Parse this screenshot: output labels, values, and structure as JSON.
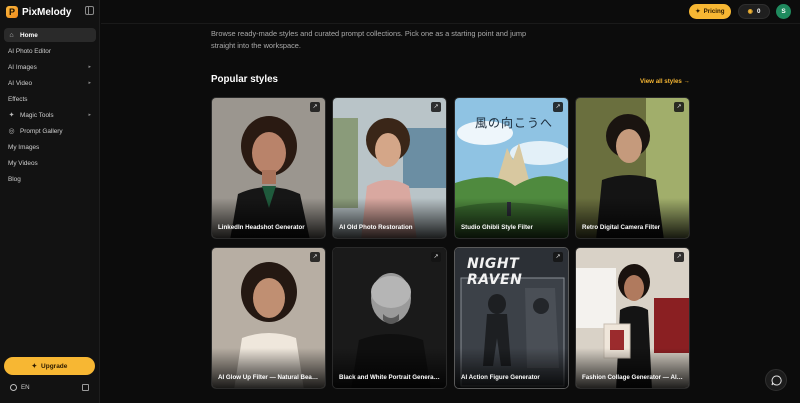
{
  "brand": {
    "name": "PixMelody"
  },
  "sidebar": {
    "items": [
      {
        "label": "Home",
        "icon": "home-icon",
        "active": true
      },
      {
        "label": "AI Photo Editor",
        "icon": "none"
      },
      {
        "label": "AI Images",
        "icon": "image-icon",
        "arrow": true
      },
      {
        "label": "AI Video",
        "icon": "video-icon",
        "arrow": true
      },
      {
        "label": "Effects",
        "icon": "effects-icon"
      },
      {
        "label": "Magic Tools",
        "icon": "magic-wand-icon",
        "arrow": true
      },
      {
        "label": "Prompt Gallery",
        "icon": "gallery-icon"
      },
      {
        "label": "My Images",
        "icon": "images-icon"
      },
      {
        "label": "My Videos",
        "icon": "videos-icon"
      },
      {
        "label": "Blog",
        "icon": "blog-icon"
      }
    ],
    "upgrade_label": "Upgrade",
    "language": "EN"
  },
  "header": {
    "pricing_label": "Pricing",
    "credits": "0",
    "avatar_initial": "S"
  },
  "main": {
    "intro": "Browse ready-made styles and curated prompt collections. Pick one as a starting point and jump straight into the workspace.",
    "section_title": "Popular styles",
    "view_all_label": "View all styles",
    "cards": [
      {
        "label": "LinkedIn Headshot Generator"
      },
      {
        "label": "AI Old Photo Restoration"
      },
      {
        "label": "Studio Ghibli Style Filter",
        "art_text": "風の向こうへ"
      },
      {
        "label": "Retro Digital Camera Filter"
      },
      {
        "label": "AI Glow Up Filter — Natural Beauty…"
      },
      {
        "label": "Black and White Portrait Generator…"
      },
      {
        "label": "AI Action Figure Generator",
        "art_text": "NIGHT RAVEN"
      },
      {
        "label": "Fashion Collage Generator — AI Ed…"
      }
    ]
  },
  "colors": {
    "accent": "#f7b733",
    "background": "#0c0c0c",
    "sidebar": "#121212",
    "avatar": "#1f8a5e"
  }
}
